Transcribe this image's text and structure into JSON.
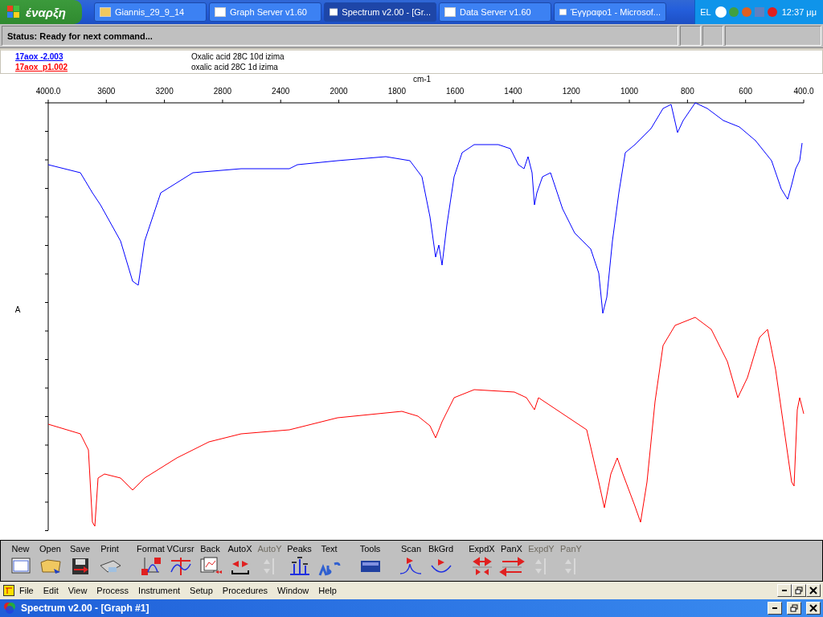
{
  "taskbar": {
    "start": "έναρξη",
    "tasks": [
      {
        "label": "Giannis_29_9_14",
        "selected": false
      },
      {
        "label": "Graph Server v1.60",
        "selected": false
      },
      {
        "label": "Spectrum v2.00 - [Gr...",
        "selected": true
      },
      {
        "label": "Data Server v1.60",
        "selected": false
      },
      {
        "label": "Έγγραφο1 - Microsof...",
        "selected": false
      }
    ],
    "language": "EL",
    "clock": "12:37 μμ"
  },
  "status_bar": {
    "text": "Status: Ready for next command..."
  },
  "legend": [
    {
      "name": "17aox -2.003",
      "description": "Oxalic acid 28C 10d izima",
      "color": "#0000ff"
    },
    {
      "name": "17aox_p1.002",
      "description": "oxalic acid 28C 1d izima",
      "color": "#ff0000"
    }
  ],
  "chart": {
    "x_axis_label": "cm-1",
    "y_axis_label": "A",
    "x_ticks": [
      "4000.0",
      "3600",
      "3200",
      "2800",
      "2400",
      "2000",
      "1800",
      "1600",
      "1400",
      "1200",
      "1000",
      "800",
      "600",
      "400.0"
    ]
  },
  "toolbar": [
    {
      "label": "New",
      "disabled": false
    },
    {
      "label": "Open",
      "disabled": false
    },
    {
      "label": "Save",
      "disabled": false
    },
    {
      "label": "Print",
      "disabled": false
    },
    {
      "label": "Format",
      "disabled": false
    },
    {
      "label": "VCursr",
      "disabled": false
    },
    {
      "label": "Back",
      "disabled": false
    },
    {
      "label": "AutoX",
      "disabled": false
    },
    {
      "label": "AutoY",
      "disabled": true
    },
    {
      "label": "Peaks",
      "disabled": false
    },
    {
      "label": "Text",
      "disabled": false
    },
    {
      "label": "Tools",
      "disabled": false
    },
    {
      "label": "Scan",
      "disabled": false
    },
    {
      "label": "BkGrd",
      "disabled": false
    },
    {
      "label": "ExpdX",
      "disabled": false
    },
    {
      "label": "PanX",
      "disabled": false
    },
    {
      "label": "ExpdY",
      "disabled": true
    },
    {
      "label": "PanY",
      "disabled": true
    }
  ],
  "menu": [
    "File",
    "Edit",
    "View",
    "Process",
    "Instrument",
    "Setup",
    "Procedures",
    "Window",
    "Help"
  ],
  "title_bar": {
    "title": "Spectrum v2.00 - [Graph #1]"
  }
}
